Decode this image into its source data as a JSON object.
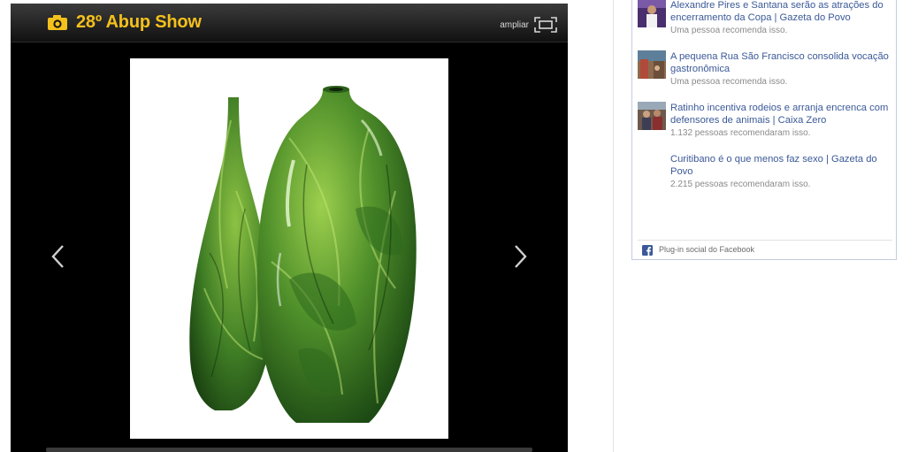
{
  "gallery": {
    "title": "28º Abup Show",
    "expand_label": "ampliar",
    "icons": {
      "camera": "camera-icon",
      "expand": "expand-icon",
      "previous": "chevron-left-icon",
      "next": "chevron-right-icon"
    },
    "colors": {
      "title": "#f4c01c",
      "background": "#000000"
    }
  },
  "facebook": {
    "items": [
      {
        "headline": "Alexandre Pires e Santana serão as atrações do encerramento da Copa | Gazeta do Povo",
        "meta": "Uma pessoa recomenda isso."
      },
      {
        "headline": "A pequena Rua São Francisco consolida vocação gastronômica",
        "meta": "Uma pessoa recomenda isso."
      },
      {
        "headline": "Ratinho incentiva rodeios e arranja encrenca com defensores de animais | Caixa Zero",
        "meta": "1.132 pessoas recomendaram isso."
      },
      {
        "headline": "Curitibano é o que menos faz sexo | Gazeta do Povo",
        "meta": "2.215 pessoas recomendaram isso."
      }
    ],
    "footer_label": "Plug-in social do Facebook",
    "colors": {
      "link": "#3b5998",
      "meta": "#8a8a8a",
      "border": "#c4cde0"
    }
  }
}
